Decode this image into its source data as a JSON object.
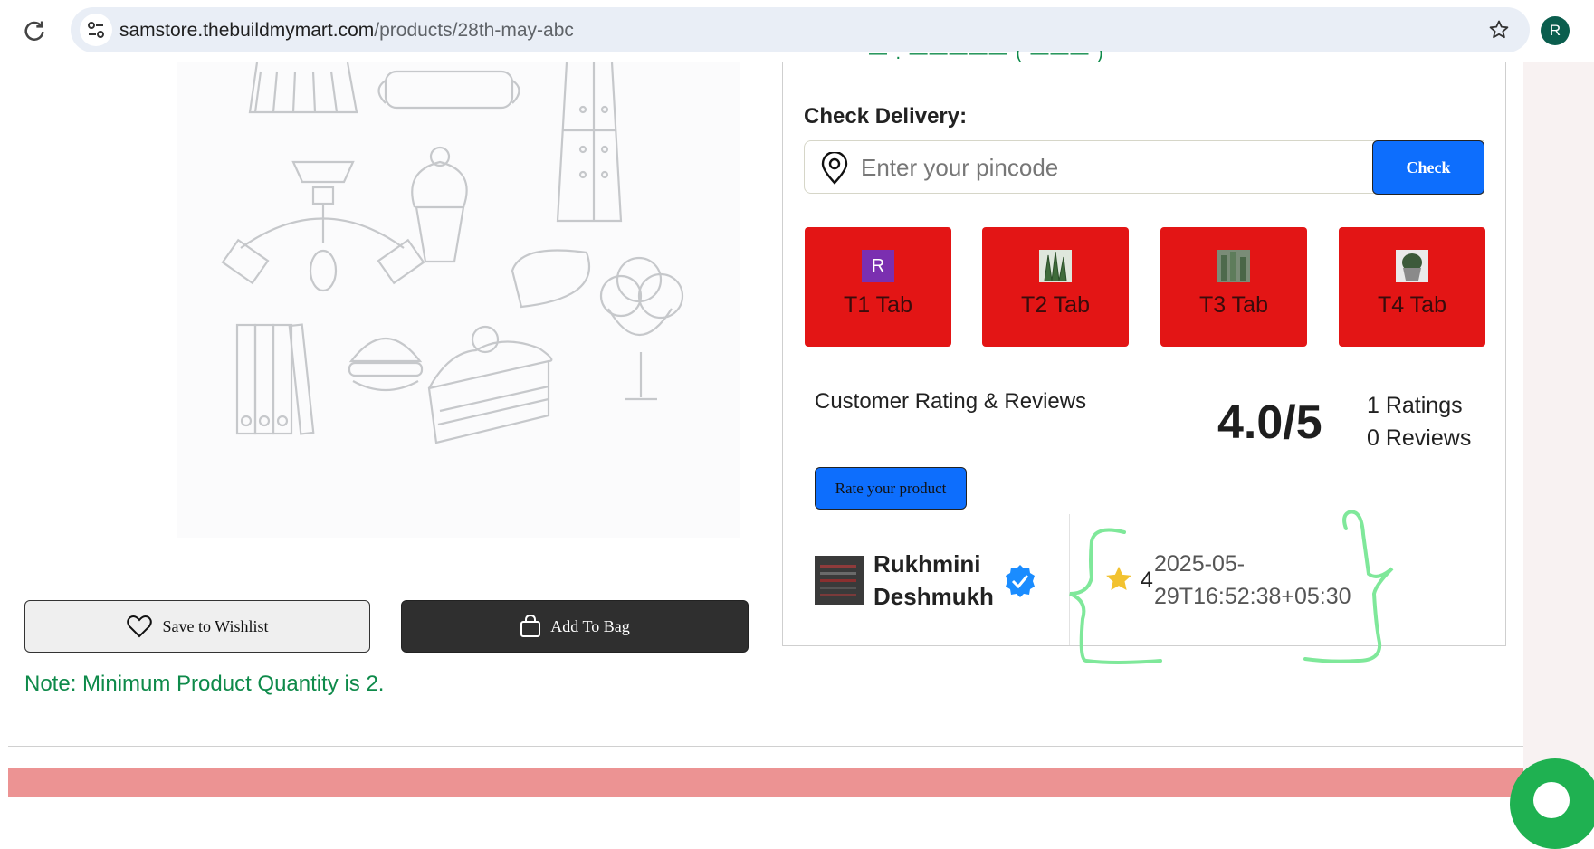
{
  "browser": {
    "url_host": "samstore.thebuildmymart.com",
    "url_path": "/products/28th-may-abc",
    "profile_initial": "R"
  },
  "product": {
    "wishlist_label": "Save to Wishlist",
    "add_to_bag_label": "Add To Bag",
    "note": "Note: Minimum Product Quantity is 2."
  },
  "delivery": {
    "title": "Check Delivery:",
    "pincode_placeholder": "Enter your pincode",
    "check_label": "Check"
  },
  "tabs": [
    {
      "label": "T1 Tab",
      "thumb": "R"
    },
    {
      "label": "T2 Tab",
      "thumb": "plant-photo"
    },
    {
      "label": "T3 Tab",
      "thumb": "cactus-photo"
    },
    {
      "label": "T4 Tab",
      "thumb": "potted-cactus-photo"
    }
  ],
  "reviews": {
    "title": "Customer Rating & Reviews",
    "average": "4.0/5",
    "ratings_count": "1 Ratings",
    "reviews_count": "0 Reviews",
    "rate_button_label": "Rate your product",
    "items": [
      {
        "name_line1": "Rukhmini",
        "name_line2": "Deshmukh",
        "rating": "4",
        "date_line1": "2025-05-",
        "date_line2": "29T16:52:38+05:30"
      }
    ]
  },
  "colors": {
    "tab_red": "#e31515",
    "primary_blue": "#0d6efd",
    "note_green": "#0e8a4a",
    "footer_pink": "#ec9393",
    "annotation_green": "#7fe89a"
  }
}
